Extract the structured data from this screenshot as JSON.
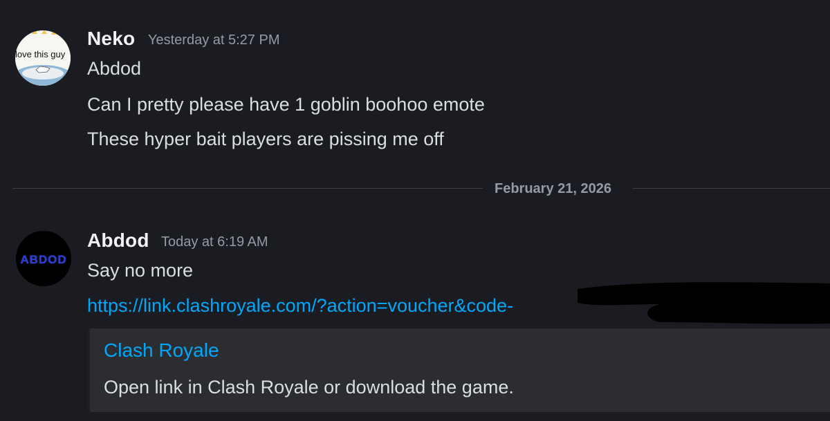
{
  "messages": [
    {
      "author": "Neko",
      "timestamp": "Yesterday at 5:27 PM",
      "avatar_text": "love this guy",
      "avatar_icon": "cat-photo-avatar",
      "lines": [
        "Abdod",
        "Can I pretty please have 1 goblin boohoo emote",
        "These hyper bait players are pissing me off"
      ]
    },
    {
      "author": "Abdod",
      "timestamp": "Today at 6:19 AM",
      "avatar_text": "ABDOD",
      "avatar_icon": "abdod-logo-avatar",
      "lines": [
        "Say no more"
      ],
      "link": "https://link.clashroyale.com/?action=voucher&code-",
      "embed": {
        "title": "Clash Royale",
        "description": "Open link in Clash Royale or download the game."
      }
    }
  ],
  "date_divider": "February 21, 2026",
  "colors": {
    "background": "#1b1c21",
    "text": "#dbdee1",
    "muted": "#949ba4",
    "link": "#00a8fc",
    "embed_bg": "#2b2d31"
  }
}
